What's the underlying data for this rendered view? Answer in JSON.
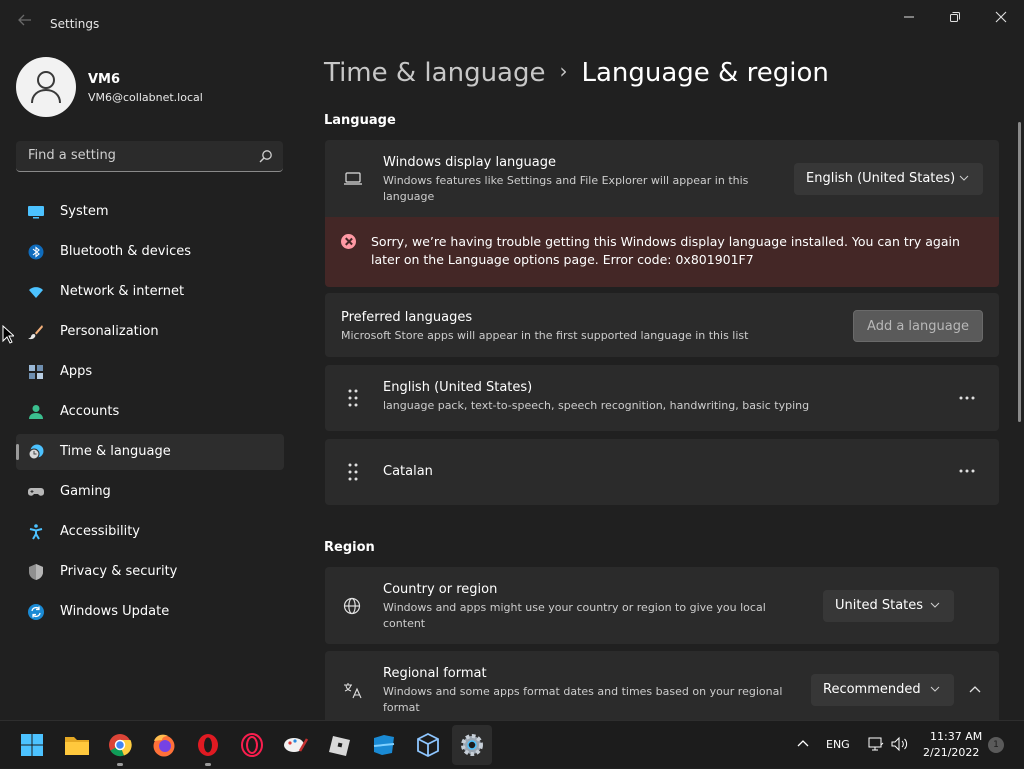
{
  "window": {
    "title": "Settings"
  },
  "user": {
    "name": "VM6",
    "email": "VM6@collabnet.local"
  },
  "search": {
    "placeholder": "Find a setting"
  },
  "sidebar": {
    "items": [
      {
        "label": "System",
        "icon": "system-icon",
        "active": false
      },
      {
        "label": "Bluetooth & devices",
        "icon": "bluetooth-icon",
        "active": false
      },
      {
        "label": "Network & internet",
        "icon": "wifi-icon",
        "active": false
      },
      {
        "label": "Personalization",
        "icon": "brush-icon",
        "active": false
      },
      {
        "label": "Apps",
        "icon": "apps-icon",
        "active": false
      },
      {
        "label": "Accounts",
        "icon": "person-icon",
        "active": false
      },
      {
        "label": "Time & language",
        "icon": "clock-globe-icon",
        "active": true
      },
      {
        "label": "Gaming",
        "icon": "gamepad-icon",
        "active": false
      },
      {
        "label": "Accessibility",
        "icon": "accessibility-icon",
        "active": false
      },
      {
        "label": "Privacy & security",
        "icon": "shield-icon",
        "active": false
      },
      {
        "label": "Windows Update",
        "icon": "update-icon",
        "active": false
      }
    ]
  },
  "breadcrumb": {
    "parent": "Time & language",
    "separator": "›",
    "current": "Language & region"
  },
  "language_section": {
    "title": "Language",
    "display_language": {
      "title": "Windows display language",
      "description": "Windows features like Settings and File Explorer will appear in this language",
      "value": "English (United States)"
    },
    "error": {
      "message": "Sorry, we’re having trouble getting this Windows display language installed. You can try again later on the Language options page. Error code: 0x801901F7"
    },
    "preferred": {
      "title": "Preferred languages",
      "description": "Microsoft Store apps will appear in the first supported language in this list",
      "button": "Add a language"
    },
    "languages": [
      {
        "name": "English (United States)",
        "features": "language pack, text-to-speech, speech recognition, handwriting, basic typing"
      },
      {
        "name": "Catalan",
        "features": ""
      }
    ]
  },
  "region_section": {
    "title": "Region",
    "country": {
      "title": "Country or region",
      "description": "Windows and apps might use your country or region to give you local content",
      "value": "United States"
    },
    "format": {
      "title": "Regional format",
      "description": "Windows and some apps format dates and times based on your regional format",
      "value": "Recommended"
    }
  },
  "taskbar": {
    "apps": [
      "start-icon",
      "file-explorer-icon",
      "chrome-icon",
      "firefox-icon",
      "opera-icon",
      "opera-gx-icon",
      "paint-icon",
      "roblox-icon",
      "azure-icon",
      "virtualbox-icon",
      "settings-icon"
    ],
    "language": "ENG",
    "time": "11:37 AM",
    "date": "2/21/2022",
    "notification_count": "1"
  },
  "colors": {
    "background": "#202020",
    "card": "#2b2b2b",
    "error_bg": "#442726",
    "error_icon": "#ff99a4",
    "accent": "#0078d4"
  }
}
